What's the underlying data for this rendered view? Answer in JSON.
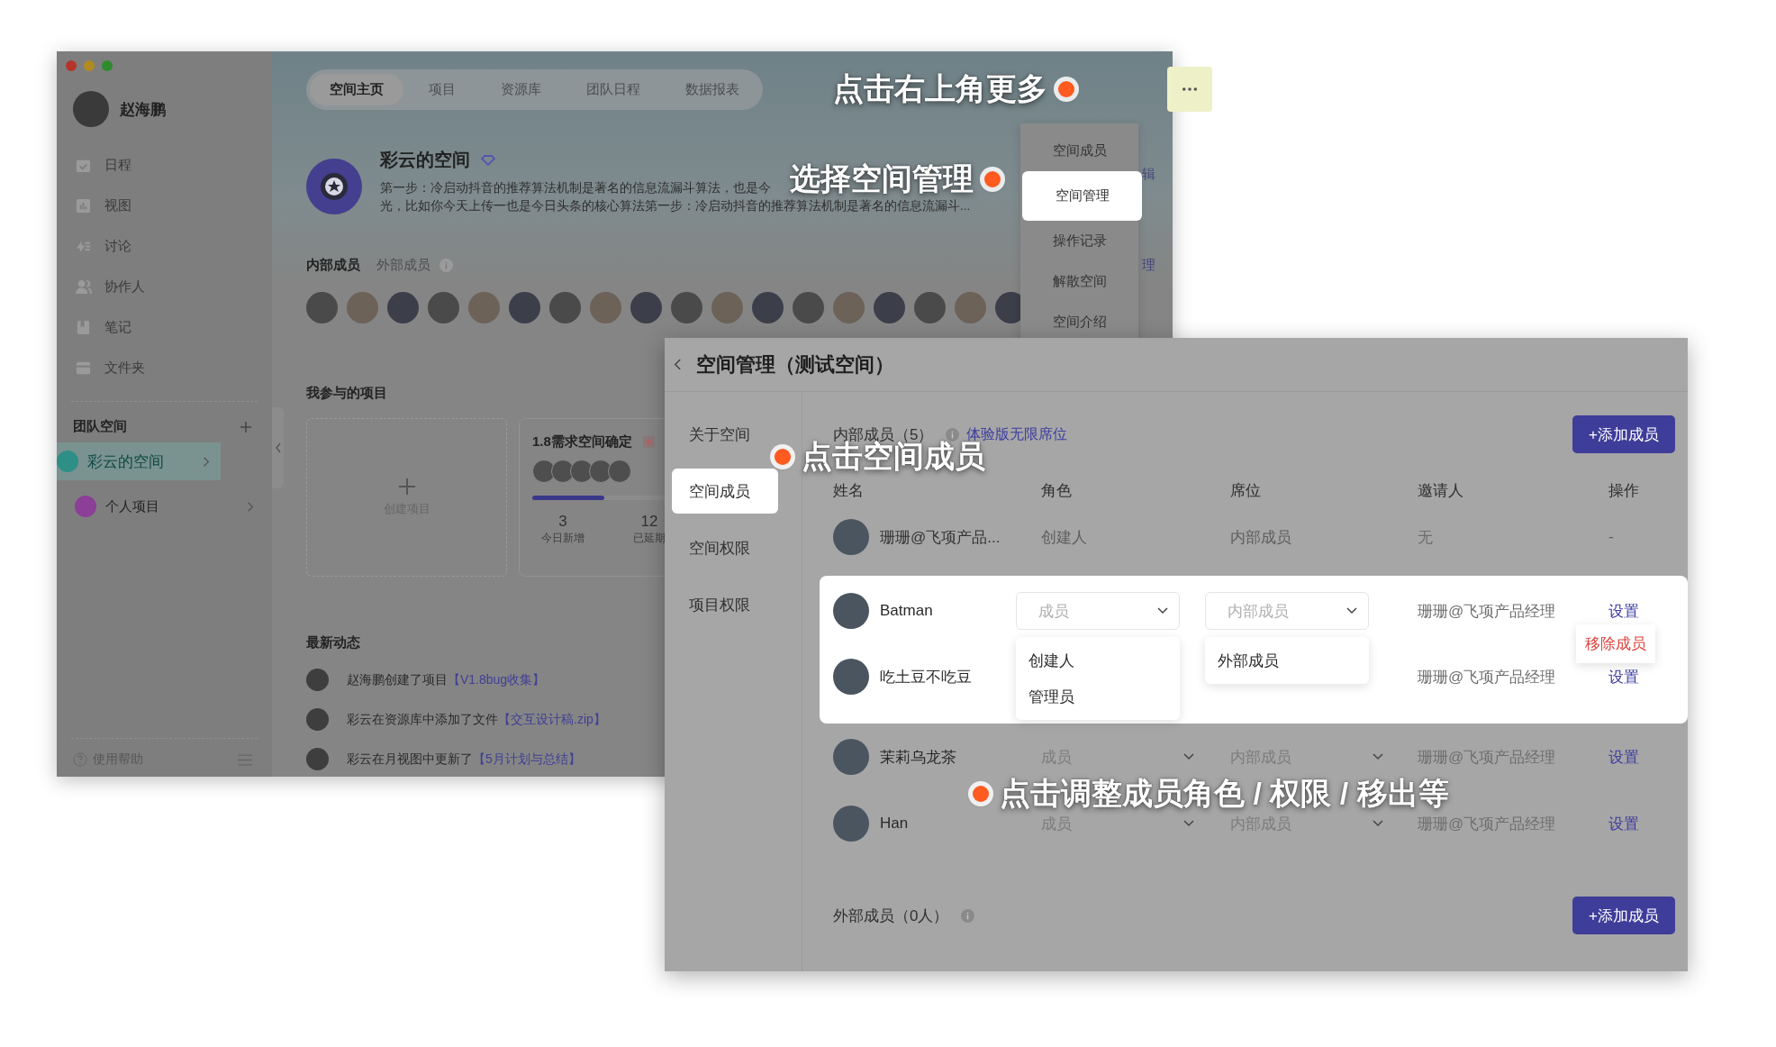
{
  "back_window": {
    "user": {
      "name": "赵海鹏"
    },
    "nav": [
      {
        "label": "日程",
        "kind": "calendar"
      },
      {
        "label": "视图",
        "kind": "chart"
      },
      {
        "label": "讨论",
        "kind": "discussion"
      },
      {
        "label": "协作人",
        "kind": "people"
      },
      {
        "label": "笔记",
        "kind": "note"
      },
      {
        "label": "文件夹",
        "kind": "folder"
      }
    ],
    "team_space": {
      "title": "团队空间",
      "items": [
        {
          "label": "彩云的空间",
          "selected": true,
          "color": "#2e8f86"
        },
        {
          "label": "个人项目",
          "selected": false,
          "color": "#8b3f96"
        }
      ]
    },
    "help": "使用帮助",
    "tabs": [
      {
        "label": "空间主页",
        "selected": true
      },
      {
        "label": "项目",
        "selected": false
      },
      {
        "label": "资源库",
        "selected": false
      },
      {
        "label": "团队日程",
        "selected": false
      },
      {
        "label": "数据报表",
        "selected": false
      }
    ],
    "space": {
      "name": "彩云的空间",
      "desc_lines": [
        "第一步：冷启动抖音的推荐算法机制是著名的信息流漏斗算法，也是今",
        "光，比如你今天上传一也是今日头条的核心算法第一步：冷启动抖音的推荐算法机制是著名的信息流漏斗..."
      ],
      "edit_fragment": "辑"
    },
    "member_tabs": [
      {
        "label": "内部成员",
        "selected": true
      },
      {
        "label": "外部成员",
        "selected": false
      }
    ],
    "manage_fragment": "理",
    "projects": {
      "title": "我参与的项目",
      "create": "创建项目",
      "card": {
        "title": "1.8需求空间确定",
        "level": 0.38,
        "stats": [
          {
            "value": "3",
            "label": "今日新增"
          },
          {
            "value": "12",
            "label": "已延期"
          }
        ]
      }
    },
    "feed": {
      "title": "最新动态",
      "items": [
        {
          "text": "赵海鹏创建了项目",
          "link": "【V1.8bug收集】"
        },
        {
          "text": "彩云在资源库中添加了文件",
          "link": "【交互设计稿.zip】"
        },
        {
          "text": "彩云在月视图中更新了",
          "link": "【5月计划与总结】"
        }
      ]
    },
    "more_menu": [
      {
        "label": "空间成员",
        "selected": false
      },
      {
        "label": "空间管理",
        "selected": true
      },
      {
        "label": "操作记录",
        "selected": false
      },
      {
        "label": "解散空间",
        "selected": false
      },
      {
        "label": "空间介绍",
        "selected": false
      }
    ]
  },
  "front_window": {
    "title": "空间管理（测试空间）",
    "nav": [
      {
        "label": "关于空间",
        "selected": false
      },
      {
        "label": "空间成员",
        "selected": true
      },
      {
        "label": "空间权限",
        "selected": false
      },
      {
        "label": "项目权限",
        "selected": false
      }
    ],
    "internal": {
      "title": "内部成员（5）",
      "note": "体验版无限席位",
      "add": "+添加成员"
    },
    "columns": [
      "姓名",
      "角色",
      "席位",
      "邀请人",
      "操作"
    ],
    "rows": [
      {
        "kind": "static",
        "highlighted": false,
        "name": "珊珊@飞项产品...",
        "role": "创建人",
        "seat": "内部成员",
        "inviter": "无",
        "action": "-"
      },
      {
        "kind": "editable",
        "highlighted": true,
        "name": "Batman",
        "role": "成员",
        "seat": "内部成员",
        "inviter": "珊珊@飞项产品经理",
        "action": "设置",
        "role_options": [
          "创建人",
          "管理员"
        ],
        "seat_options": [
          "外部成员"
        ],
        "action_options": [
          "移除成员"
        ]
      },
      {
        "kind": "editable",
        "highlighted": true,
        "name": "吃土豆不吃豆",
        "inviter": "珊珊@飞项产品经理",
        "action": "设置"
      },
      {
        "kind": "editable",
        "highlighted": false,
        "name": "茉莉乌龙茶",
        "role": "成员",
        "seat": "内部成员",
        "inviter": "珊珊@飞项产品经理",
        "action": "设置"
      },
      {
        "kind": "editable",
        "highlighted": false,
        "name": "Han",
        "role": "成员",
        "seat": "内部成员",
        "inviter": "珊珊@飞项产品经理",
        "action": "设置"
      }
    ],
    "external": {
      "title": "外部成员（0人）",
      "add": "+添加成员"
    }
  },
  "callouts": [
    {
      "text": "点击右上角更多",
      "kind": "more"
    },
    {
      "text": "选择空间管理",
      "kind": "manage"
    },
    {
      "text": "点击空间成员",
      "kind": "members"
    },
    {
      "text": "点击调整成员角色 / 权限 / 移出等",
      "kind": "adjust"
    }
  ]
}
